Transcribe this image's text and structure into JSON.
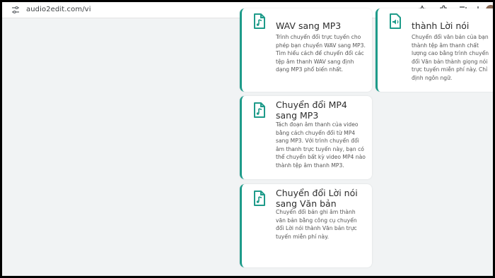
{
  "browser": {
    "url": "audio2edit.com/vi"
  },
  "cards": [
    {
      "title": "WAV sang MP3",
      "description": "Trình chuyển đổi trực tuyến cho phép bạn chuyển WAV sang MP3. Tìm hiểu cách để chuyển đổi các tệp âm thanh WAV sang định dạng MP3 phổ biến nhất.",
      "icon": "music-file-icon"
    },
    {
      "title": "thành Lời nói",
      "description": "Chuyển đổi văn bản của bạn thành tệp âm thanh chất lượng cao bằng trình chuyển đổi Văn bản thành giọng nói trực tuyến miễn phí này. Chỉ định ngôn ngữ.",
      "icon": "speaker-file-icon"
    },
    {
      "title": "Chuyển đổi MP4 sang MP3",
      "description": "Tách đoạn âm thanh của video bằng cách chuyển đổi từ MP4 sang MP3. Với trình chuyển đổi âm thanh trực tuyến này, bạn có thể chuyển bất kỳ video MP4 nào thành tệp âm thanh MP3.",
      "icon": "music-file-icon"
    },
    {
      "title": "Chuyển đổi Lời nói sang Văn bản",
      "description": "Chuyển đổi bản ghi âm thành văn bản bằng công cụ chuyển đổi Lời nói thành Văn bản trực tuyến miễn phí này.",
      "icon": "music-file-icon"
    }
  ],
  "colors": {
    "accent": "#1e9b8a"
  }
}
